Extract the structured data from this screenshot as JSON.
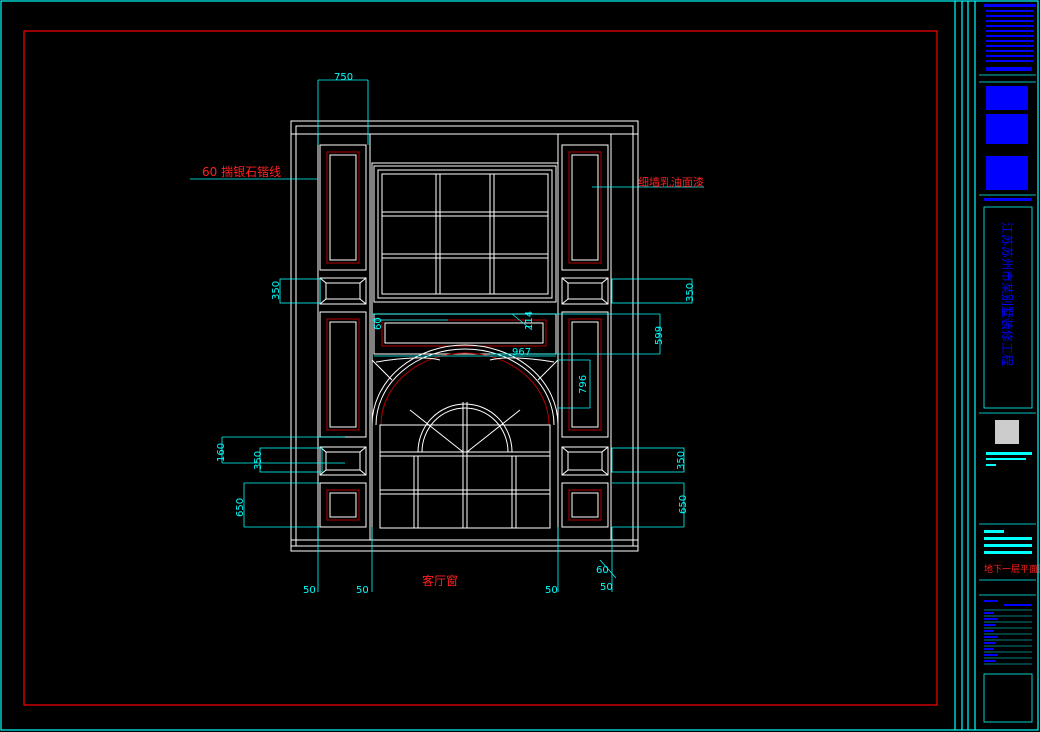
{
  "colors": {
    "background": "#000000",
    "frame": "#00ffff",
    "border": "#ff0000",
    "drawing": "#ffffff",
    "dimension": "#00ffff",
    "label": "#ff2020",
    "titleblock_fill": "#0000ff",
    "panel_inner": "#b40000"
  },
  "labels": {
    "stone_line": "60 揣银石锴线",
    "wall_paint": "细墙乳油面漆",
    "view_title": "客厅窗"
  },
  "dimensions": {
    "top_width": "750",
    "left_350_upper": "350",
    "right_350_upper": "350",
    "d60": "60",
    "d114": "114",
    "d599": "599",
    "d967": "967",
    "d796": "796",
    "d160": "160",
    "left_350_lower": "350",
    "right_350_lower": "350",
    "left_650": "650",
    "right_650": "650",
    "b50_1": "50",
    "b50_2": "50",
    "b50_3": "50",
    "b60": "60",
    "b50_4": "50"
  },
  "title_block": {
    "project_name": "江苏苏州市某别墅装修工程",
    "drawing_name": "地下一层平面图"
  }
}
